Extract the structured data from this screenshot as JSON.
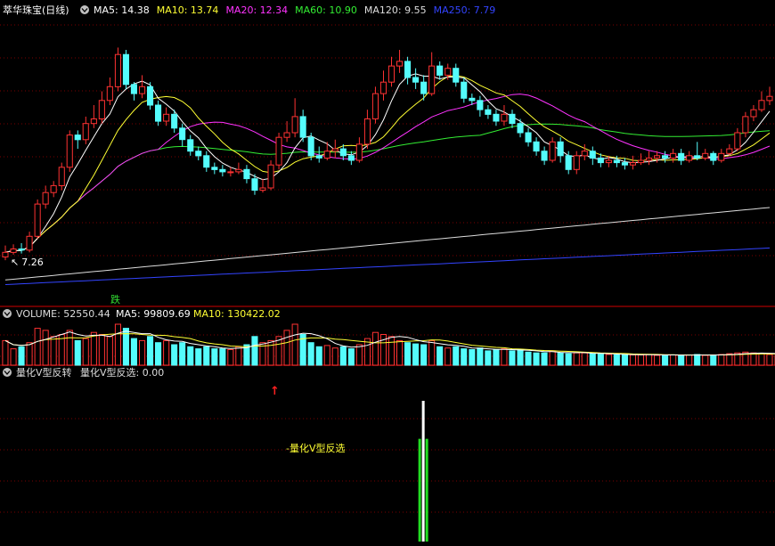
{
  "header": {
    "title": "萃华珠宝(日线)",
    "ma": [
      {
        "label": "MA5: 14.38",
        "color": "#ffffff"
      },
      {
        "label": "MA10: 13.74",
        "color": "#ffff33"
      },
      {
        "label": "MA20: 12.34",
        "color": "#ff33ff"
      },
      {
        "label": "MA60: 10.90",
        "color": "#33ee33"
      },
      {
        "label": "MA120: 9.55",
        "color": "#dddddd"
      },
      {
        "label": "MA250: 7.79",
        "color": "#3344ff"
      }
    ]
  },
  "volume_header": {
    "title": "VOLUME: 52550.44",
    "ma5": "MA5: 99809.69",
    "ma10": "MA10: 130422.02"
  },
  "indicator_header": {
    "name": "量化V型反转",
    "value_label": "量化V型反选: 0.00"
  },
  "annotations": {
    "low_price": "7.26",
    "die_label": "跌",
    "signal_label": "量化V型反选",
    "signal_arrow": "↑"
  },
  "colors": {
    "up": "#ff3232",
    "down": "#54fcfc",
    "grid": "#7a0000",
    "separator": "#8b0000",
    "bar_green": "#22dd22",
    "bar_white": "#ffffff",
    "label_yellow": "#ffff33",
    "label_green": "#33dd33"
  },
  "chart_data": {
    "type": "candlestick",
    "candles": [
      [
        7.4,
        7.6,
        7.9,
        7.26
      ],
      [
        7.6,
        7.75,
        7.95,
        7.5
      ],
      [
        7.75,
        7.7,
        8.0,
        7.55
      ],
      [
        7.7,
        8.3,
        8.5,
        7.6
      ],
      [
        8.3,
        9.7,
        9.9,
        8.2
      ],
      [
        9.7,
        10.2,
        10.5,
        9.5
      ],
      [
        10.2,
        10.5,
        10.7,
        10.0
      ],
      [
        10.5,
        11.3,
        11.5,
        10.3
      ],
      [
        11.3,
        12.7,
        12.9,
        11.1
      ],
      [
        12.7,
        12.5,
        12.9,
        12.1
      ],
      [
        12.5,
        13.2,
        13.5,
        12.3
      ],
      [
        13.2,
        13.4,
        14.0,
        13.0
      ],
      [
        13.4,
        14.2,
        14.6,
        13.2
      ],
      [
        14.2,
        14.8,
        15.2,
        14.0
      ],
      [
        14.8,
        16.2,
        16.5,
        14.6
      ],
      [
        16.2,
        14.9,
        16.4,
        14.7
      ],
      [
        14.9,
        14.5,
        15.0,
        14.2
      ],
      [
        14.5,
        14.8,
        15.3,
        14.3
      ],
      [
        14.8,
        14.0,
        15.0,
        13.8
      ],
      [
        14.0,
        13.3,
        14.2,
        13.1
      ],
      [
        13.3,
        13.6,
        13.9,
        13.1
      ],
      [
        13.6,
        13.0,
        13.8,
        12.8
      ],
      [
        13.0,
        12.5,
        13.2,
        12.2
      ],
      [
        12.5,
        12.0,
        12.7,
        11.8
      ],
      [
        12.0,
        11.8,
        12.2,
        11.6
      ],
      [
        11.8,
        11.3,
        12.0,
        11.1
      ],
      [
        11.3,
        11.2,
        11.5,
        11.0
      ],
      [
        11.2,
        11.1,
        11.4,
        10.9
      ],
      [
        11.1,
        11.1,
        11.3,
        10.9
      ],
      [
        11.1,
        11.2,
        11.5,
        11.0
      ],
      [
        11.2,
        10.8,
        11.4,
        10.6
      ],
      [
        10.8,
        10.3,
        11.0,
        10.1
      ],
      [
        10.3,
        10.4,
        10.8,
        10.2
      ],
      [
        10.4,
        11.4,
        11.6,
        10.3
      ],
      [
        11.4,
        12.6,
        12.8,
        11.2
      ],
      [
        12.6,
        12.8,
        13.3,
        12.4
      ],
      [
        12.8,
        13.5,
        14.3,
        12.6
      ],
      [
        13.5,
        12.6,
        13.8,
        12.4
      ],
      [
        12.6,
        11.8,
        12.8,
        11.6
      ],
      [
        11.8,
        11.7,
        12.2,
        11.5
      ],
      [
        11.7,
        12.0,
        12.4,
        11.6
      ],
      [
        12.0,
        12.1,
        12.5,
        11.7
      ],
      [
        12.1,
        11.8,
        12.3,
        11.6
      ],
      [
        11.8,
        11.6,
        12.0,
        11.4
      ],
      [
        11.6,
        12.3,
        12.6,
        11.5
      ],
      [
        12.3,
        13.4,
        13.8,
        12.1
      ],
      [
        13.4,
        14.5,
        14.8,
        13.2
      ],
      [
        14.5,
        15.0,
        15.5,
        14.2
      ],
      [
        15.0,
        15.7,
        16.1,
        14.8
      ],
      [
        15.7,
        15.9,
        16.4,
        15.4
      ],
      [
        15.9,
        15.2,
        16.1,
        14.9
      ],
      [
        15.2,
        15.0,
        15.6,
        14.7
      ],
      [
        15.0,
        14.5,
        15.3,
        14.2
      ],
      [
        14.5,
        15.7,
        16.3,
        14.4
      ],
      [
        15.7,
        15.3,
        15.9,
        15.1
      ],
      [
        15.3,
        15.6,
        15.8,
        15.1
      ],
      [
        15.6,
        15.0,
        15.8,
        14.8
      ],
      [
        15.0,
        14.3,
        15.2,
        14.1
      ],
      [
        14.3,
        14.2,
        14.5,
        14.0
      ],
      [
        14.2,
        13.8,
        14.4,
        13.5
      ],
      [
        13.8,
        13.6,
        14.0,
        13.4
      ],
      [
        13.6,
        13.3,
        13.8,
        13.1
      ],
      [
        13.3,
        13.6,
        14.0,
        13.1
      ],
      [
        13.6,
        13.2,
        13.8,
        13.0
      ],
      [
        13.2,
        12.8,
        13.4,
        12.6
      ],
      [
        12.8,
        12.4,
        13.0,
        12.2
      ],
      [
        12.4,
        12.0,
        12.6,
        11.8
      ],
      [
        12.0,
        11.6,
        12.2,
        11.4
      ],
      [
        11.6,
        12.4,
        12.6,
        11.5
      ],
      [
        12.4,
        11.8,
        12.6,
        11.5
      ],
      [
        11.8,
        11.2,
        12.0,
        11.0
      ],
      [
        11.2,
        11.8,
        12.0,
        11.0
      ],
      [
        11.8,
        12.0,
        12.3,
        11.6
      ],
      [
        12.0,
        11.7,
        12.2,
        11.4
      ],
      [
        11.7,
        11.5,
        11.9,
        11.3
      ],
      [
        11.5,
        11.6,
        11.8,
        11.3
      ],
      [
        11.6,
        11.5,
        11.8,
        11.3
      ],
      [
        11.5,
        11.4,
        11.7,
        11.2
      ],
      [
        11.4,
        11.5,
        11.8,
        11.2
      ],
      [
        11.5,
        11.6,
        11.9,
        11.4
      ],
      [
        11.6,
        11.7,
        12.0,
        11.4
      ],
      [
        11.7,
        11.8,
        12.0,
        11.5
      ],
      [
        11.8,
        11.7,
        12.0,
        11.5
      ],
      [
        11.7,
        11.9,
        12.1,
        11.5
      ],
      [
        11.9,
        11.6,
        12.1,
        11.4
      ],
      [
        11.6,
        11.8,
        12.0,
        11.5
      ],
      [
        11.8,
        11.7,
        12.4,
        11.6
      ],
      [
        11.7,
        11.9,
        12.1,
        11.6
      ],
      [
        11.9,
        11.6,
        12.0,
        11.4
      ],
      [
        11.6,
        11.9,
        12.1,
        11.5
      ],
      [
        11.9,
        12.1,
        12.3,
        11.8
      ],
      [
        12.1,
        12.8,
        13.0,
        12.0
      ],
      [
        12.8,
        13.5,
        13.7,
        12.6
      ],
      [
        13.5,
        13.8,
        14.0,
        13.3
      ],
      [
        13.8,
        14.2,
        14.6,
        13.7
      ],
      [
        14.2,
        14.38,
        14.8,
        14.0
      ]
    ],
    "ma": {
      "MA120": {
        "start": 6.4,
        "end": 9.55
      },
      "MA250": {
        "start": 6.2,
        "end": 7.79
      }
    },
    "volume": [
      60,
      40,
      45,
      55,
      90,
      85,
      70,
      75,
      85,
      60,
      65,
      80,
      75,
      70,
      100,
      90,
      65,
      60,
      70,
      55,
      60,
      50,
      55,
      45,
      40,
      45,
      40,
      40,
      38,
      45,
      50,
      70,
      55,
      60,
      70,
      85,
      100,
      75,
      55,
      45,
      48,
      42,
      45,
      40,
      50,
      65,
      80,
      75,
      70,
      60,
      55,
      52,
      50,
      60,
      45,
      42,
      45,
      40,
      38,
      42,
      35,
      38,
      40,
      35,
      38,
      32,
      30,
      30,
      35,
      30,
      28,
      30,
      30,
      28,
      27,
      26,
      25,
      26,
      25,
      25,
      26,
      24,
      25,
      25,
      24,
      25,
      26,
      24,
      25,
      26,
      28,
      30,
      32,
      30,
      28,
      26,
      24
    ],
    "signal": {
      "index": 52,
      "green_height": 0.73,
      "white_height": 1.0
    }
  }
}
